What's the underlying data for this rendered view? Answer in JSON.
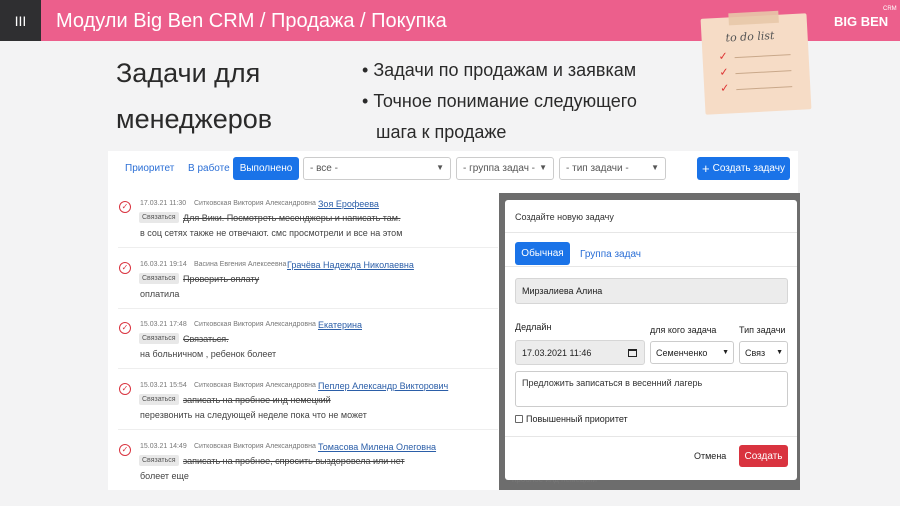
{
  "header": {
    "menu_icon": "III",
    "title": "Модули Big Ben CRM / Продажа / Покупка"
  },
  "logo": {
    "text": "BIG BEN",
    "small": "CRM"
  },
  "slide": {
    "heading_line1": "Задачи для",
    "heading_line2": "менеджеров",
    "bullet1": "Задачи по продажам и заявкам",
    "bullet2_line1": "Точное понимание следующего",
    "bullet2_line2": "шага к продаже",
    "note_title": "to do list"
  },
  "toolbar": {
    "priority": "Приоритет",
    "in_work": "В работе",
    "done": "Выполнено",
    "filter_all": "- все -",
    "filter_group": "- группа задач -",
    "filter_type": "- тип задачи -",
    "create": "Создать задачу"
  },
  "tasks": [
    {
      "date": "17.03.21 11:30",
      "author": "Ситковская Виктория Александровна",
      "client": "Зоя Ерофеева",
      "badge": "Связаться",
      "title": "Для Вики. Посмотреть месенджеры и написать там.",
      "note": "в соц сетях также не отвечают. смс просмотрели и все на этом"
    },
    {
      "date": "16.03.21 19:14",
      "author": "Васина Евгения Алексеевна",
      "client": "Грачёва Надежда Николаевна",
      "badge": "Связаться",
      "title": "Проверить оплату",
      "note": "оплатила"
    },
    {
      "date": "15.03.21 17:48",
      "author": "Ситковская Виктория Александровна",
      "client": "Екатерина",
      "badge": "Связаться",
      "title": "Связаться.",
      "note": "на больничном , ребенок болеет"
    },
    {
      "date": "15.03.21 15:54",
      "author": "Ситковская Виктория Александровна",
      "client": "Пеплер Александр Викторович",
      "badge": "Связаться",
      "title": "записать на пробное инд немецкий",
      "note": "перезвонить на следующей неделе пока что не может"
    },
    {
      "date": "15.03.21 14:49",
      "author": "Ситковская Виктория Александровна",
      "client": "Томасова Милена Олеговна",
      "badge": "Связаться",
      "title": "записать на пробное, спросить выздоровела или нет",
      "note": "болеет еще"
    }
  ],
  "modal": {
    "title": "Создайте новую задачу",
    "tab_regular": "Обычная",
    "tab_group": "Группа задач",
    "client_value": "Мирзалиева Алина",
    "deadline_label": "Дедлайн",
    "deadline_value": "17.03.2021 11:46",
    "assignee_label": "для кого задача",
    "assignee_value": "Семенченко",
    "type_label": "Тип задачи",
    "type_value": "Связ",
    "description": "Предложить записаться в весенний лагерь",
    "priority_checkbox": "Повышенный приоритет",
    "cancel": "Отмена",
    "create": "Создать",
    "behind_text": "пробное инд немецкий"
  },
  "colors": {
    "header": "#ec5f8c",
    "primary": "#1a73e8",
    "danger": "#d9333f"
  }
}
